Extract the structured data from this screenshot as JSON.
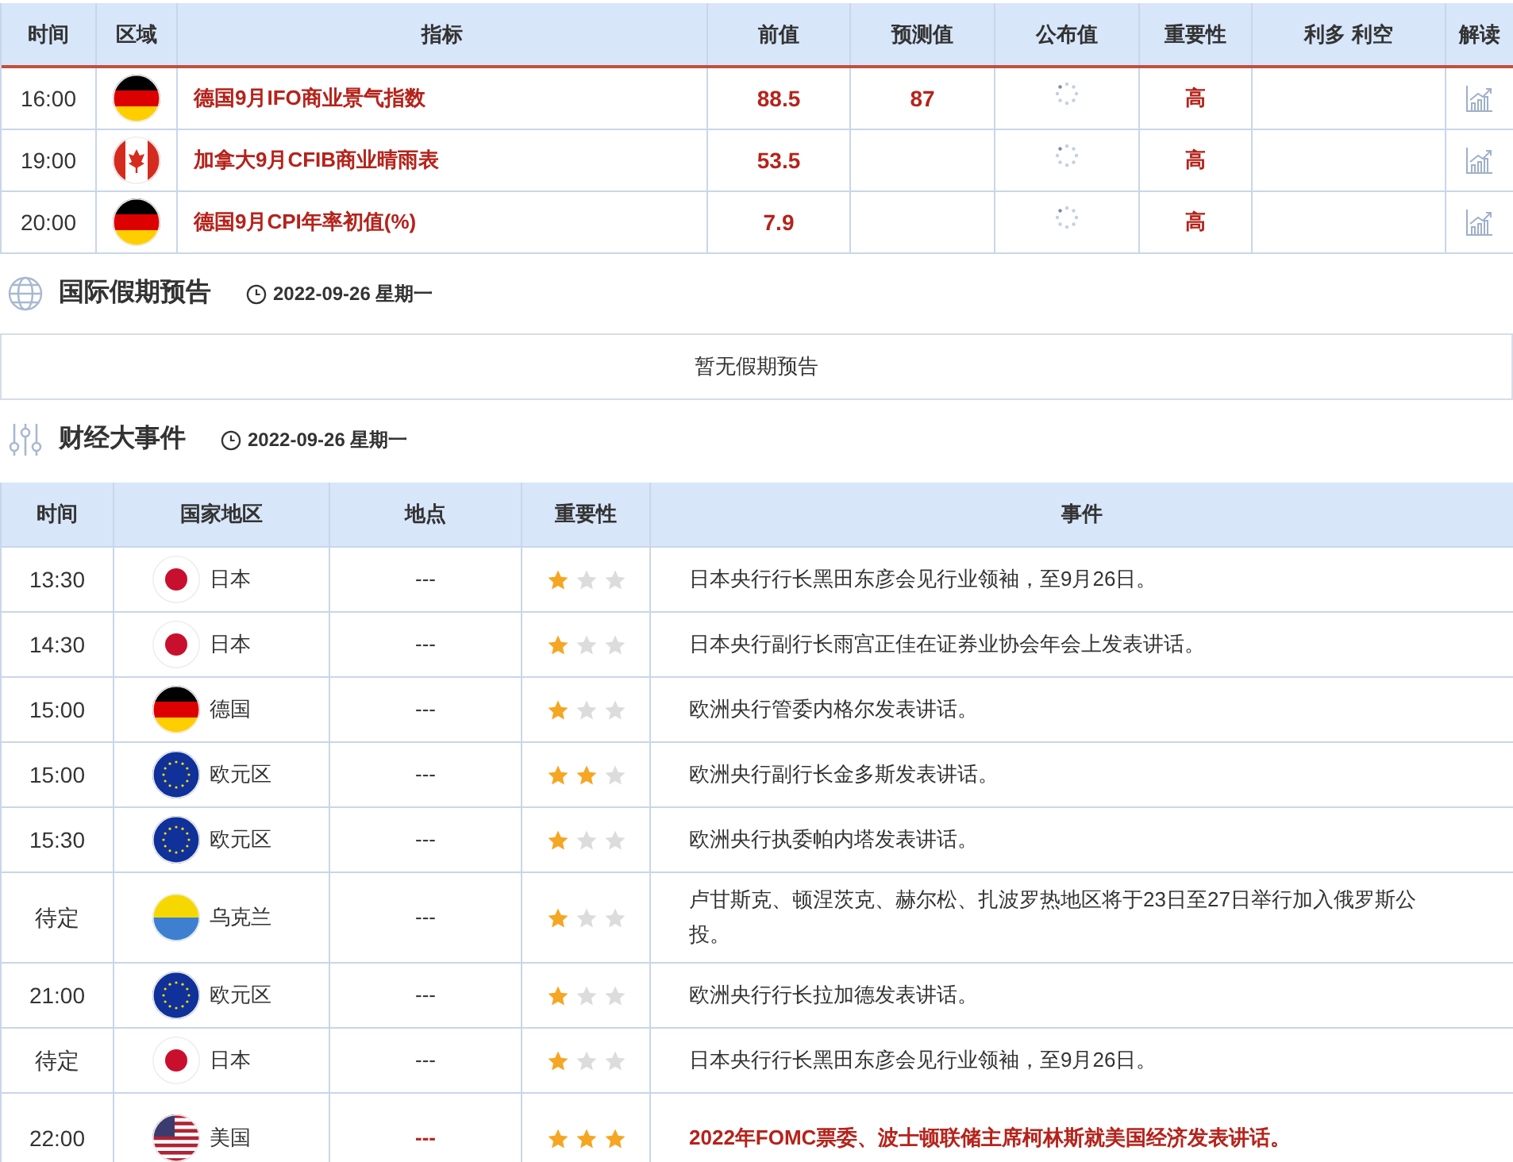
{
  "indicators": {
    "columns": [
      "时间",
      "区域",
      "指标",
      "前值",
      "预测值",
      "公布值",
      "重要性",
      "利多 利空",
      "解读"
    ],
    "rows": [
      {
        "time": "16:00",
        "kind": "de",
        "name": "德国9月IFO商业景气指数",
        "previous": "88.5",
        "forecast": "87",
        "importance": "高"
      },
      {
        "time": "19:00",
        "kind": "ca",
        "name": "加拿大9月CFIB商业晴雨表",
        "previous": "53.5",
        "importance": "高"
      },
      {
        "time": "20:00",
        "kind": "de",
        "name": "德国9月CPI年率初值(%)",
        "previous": "7.9",
        "importance": "高"
      }
    ]
  },
  "holidays": {
    "title": "国际假期预告",
    "date": "2022-09-26 星期一",
    "empty_message": "暂无假期预告"
  },
  "events": {
    "title": "财经大事件",
    "date": "2022-09-26 星期一",
    "columns": [
      "时间",
      "国家地区",
      "地点",
      "重要性",
      "事件"
    ],
    "rows": [
      {
        "time": "13:30",
        "kind": "jp",
        "country": "日本",
        "place": "---",
        "stars": 1,
        "highlight": false,
        "event": "日本央行行长黑田东彦会见行业领袖，至9月26日。"
      },
      {
        "time": "14:30",
        "kind": "jp",
        "country": "日本",
        "place": "---",
        "stars": 1,
        "highlight": false,
        "event": "日本央行副行长雨宫正佳在证券业协会年会上发表讲话。"
      },
      {
        "time": "15:00",
        "kind": "de",
        "country": "德国",
        "place": "---",
        "stars": 1,
        "highlight": false,
        "event": "欧洲央行管委内格尔发表讲话。"
      },
      {
        "time": "15:00",
        "kind": "eu",
        "country": "欧元区",
        "place": "---",
        "stars": 2,
        "highlight": false,
        "event": "欧洲央行副行长金多斯发表讲话。"
      },
      {
        "time": "15:30",
        "kind": "eu",
        "country": "欧元区",
        "place": "---",
        "stars": 1,
        "highlight": false,
        "event": "欧洲央行执委帕内塔发表讲话。"
      },
      {
        "time": "待定",
        "kind": "ua",
        "country": "乌克兰",
        "place": "---",
        "stars": 1,
        "highlight": false,
        "event": "卢甘斯克、顿涅茨克、赫尔松、扎波罗热地区将于23日至27日举行加入俄罗斯公投。"
      },
      {
        "time": "21:00",
        "kind": "eu",
        "country": "欧元区",
        "place": "---",
        "stars": 1,
        "highlight": false,
        "event": "欧洲央行行长拉加德发表讲话。"
      },
      {
        "time": "待定",
        "kind": "jp",
        "country": "日本",
        "place": "---",
        "stars": 1,
        "highlight": false,
        "event": "日本央行行长黑田东彦会见行业领袖，至9月26日。"
      },
      {
        "time": "22:00",
        "kind": "us",
        "country": "美国",
        "place": "---",
        "stars": 3,
        "highlight": true,
        "event": "2022年FOMC票委、波士顿联储主席柯林斯就美国经济发表讲话。"
      }
    ]
  }
}
